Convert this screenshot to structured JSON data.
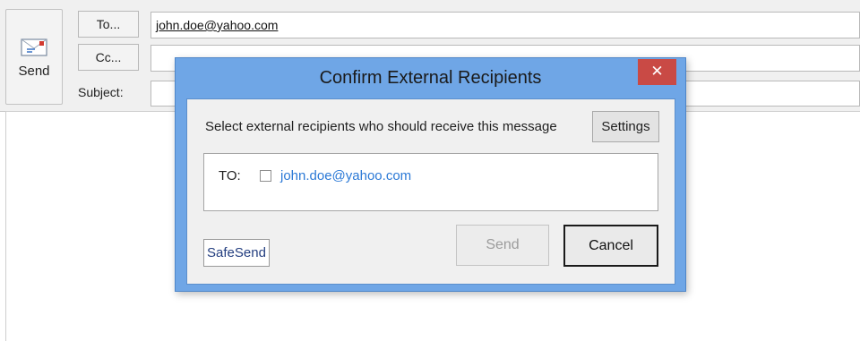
{
  "compose": {
    "send_label": "Send",
    "to_button": "To...",
    "cc_button": "Cc...",
    "subject_label": "Subject:",
    "to_value": "john.doe@yahoo.com",
    "cc_value": "",
    "subject_value": ""
  },
  "dialog": {
    "title": "Confirm External Recipients",
    "close_glyph": "✕",
    "prompt": "Select external recipients who should receive this message",
    "settings_button": "Settings",
    "recipient_type": "TO:",
    "recipients": [
      {
        "address": "john.doe@yahoo.com",
        "checked": false
      }
    ],
    "brand": "SafeSend",
    "send_button": "Send",
    "cancel_button": "Cancel"
  },
  "colors": {
    "dialog_frame": "#6fa6e6",
    "close_button": "#c94a45",
    "link_blue": "#2b79d6"
  },
  "icons": {
    "send": "envelope-send-icon",
    "close": "close-icon"
  }
}
